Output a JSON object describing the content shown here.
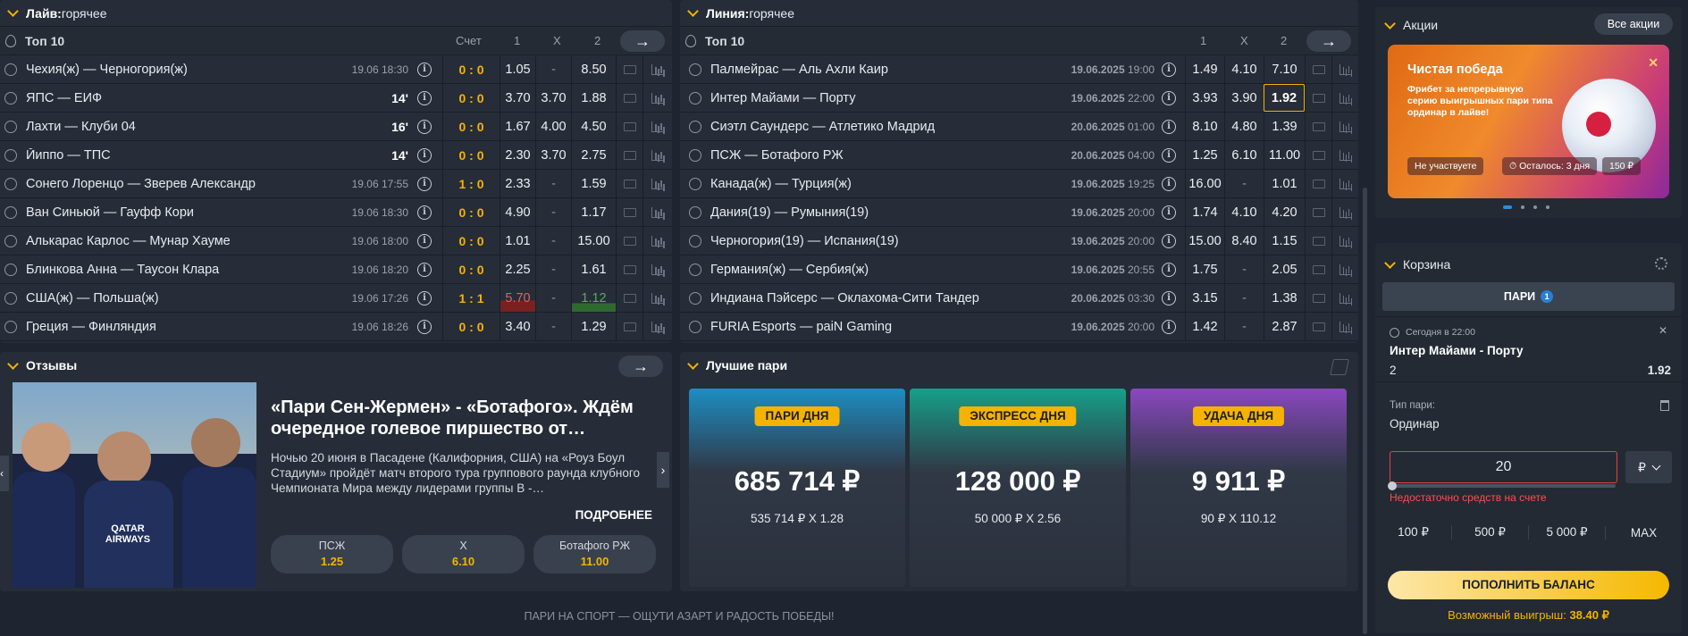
{
  "live": {
    "title_bold": "Лайв:",
    "title_rest": " горячее",
    "top": "Топ 10",
    "h_score": "Счет",
    "h1": "1",
    "hx": "X",
    "h2": "2",
    "rows": [
      {
        "name": "Чехия(ж) — Черногория(ж)",
        "date": "19.06",
        "time": "18:30",
        "min": "",
        "score": "0 : 0",
        "o1": "1.05",
        "ox": "-",
        "o2": "8.50",
        "hl": ""
      },
      {
        "name": "ЯПС — ЕИФ",
        "date": "",
        "time": "",
        "min": "14'",
        "score": "0 : 0",
        "o1": "3.70",
        "ox": "3.70",
        "o2": "1.88",
        "hl": ""
      },
      {
        "name": "Лахти — Клуби 04",
        "date": "",
        "time": "",
        "min": "16'",
        "score": "0 : 0",
        "o1": "1.67",
        "ox": "4.00",
        "o2": "4.50",
        "hl": ""
      },
      {
        "name": "Йиппо — ТПС",
        "date": "",
        "time": "",
        "min": "14'",
        "score": "0 : 0",
        "o1": "2.30",
        "ox": "3.70",
        "o2": "2.75",
        "hl": ""
      },
      {
        "name": "Сонего Лоренцо — Зверев Александр",
        "date": "19.06",
        "time": "17:55",
        "min": "",
        "score": "1 : 0",
        "o1": "2.33",
        "ox": "-",
        "o2": "1.59",
        "hl": ""
      },
      {
        "name": "Ван Синьюй — Гауфф Кори",
        "date": "19.06",
        "time": "18:30",
        "min": "",
        "score": "0 : 0",
        "o1": "4.90",
        "ox": "-",
        "o2": "1.17",
        "hl": ""
      },
      {
        "name": "Алькарас Карлос — Мунар Хауме",
        "date": "19.06",
        "time": "18:00",
        "min": "",
        "score": "0 : 0",
        "o1": "1.01",
        "ox": "-",
        "o2": "15.00",
        "hl": ""
      },
      {
        "name": "Блинкова Анна — Таусон Клара",
        "date": "19.06",
        "time": "18:20",
        "min": "",
        "score": "0 : 0",
        "o1": "2.25",
        "ox": "-",
        "o2": "1.61",
        "hl": ""
      },
      {
        "name": "США(ж) — Польша(ж)",
        "date": "19.06",
        "time": "17:26",
        "min": "",
        "score": "1 : 1",
        "o1": "5.70",
        "ox": "-",
        "o2": "1.12",
        "hl": "down-up"
      },
      {
        "name": "Греция — Финляндия",
        "date": "19.06",
        "time": "18:26",
        "min": "",
        "score": "0 : 0",
        "o1": "3.40",
        "ox": "-",
        "o2": "1.29",
        "hl": ""
      }
    ]
  },
  "line": {
    "title_bold": "Линия:",
    "title_rest": " горячее",
    "top": "Топ 10",
    "h1": "1",
    "hx": "X",
    "h2": "2",
    "rows": [
      {
        "name": "Палмейрас — Аль Ахли Каир",
        "date": "19.06.2025",
        "time": "19:00",
        "o1": "1.49",
        "ox": "4.10",
        "o2": "7.10"
      },
      {
        "name": "Интер Майами — Порту",
        "date": "19.06.2025",
        "time": "22:00",
        "o1": "3.93",
        "ox": "3.90",
        "o2": "1.92"
      },
      {
        "name": "Сиэтл Саундерс — Атлетико Мадрид",
        "date": "20.06.2025",
        "time": "01:00",
        "o1": "8.10",
        "ox": "4.80",
        "o2": "1.39"
      },
      {
        "name": "ПСЖ — Ботафого РЖ",
        "date": "20.06.2025",
        "time": "04:00",
        "o1": "1.25",
        "ox": "6.10",
        "o2": "11.00"
      },
      {
        "name": "Канада(ж) — Турция(ж)",
        "date": "19.06.2025",
        "time": "19:25",
        "o1": "16.00",
        "ox": "-",
        "o2": "1.01"
      },
      {
        "name": "Дания(19) — Румыния(19)",
        "date": "19.06.2025",
        "time": "20:00",
        "o1": "1.74",
        "ox": "4.10",
        "o2": "4.20"
      },
      {
        "name": "Черногория(19) — Испания(19)",
        "date": "19.06.2025",
        "time": "20:00",
        "o1": "15.00",
        "ox": "8.40",
        "o2": "1.15"
      },
      {
        "name": "Германия(ж) — Сербия(ж)",
        "date": "19.06.2025",
        "time": "20:55",
        "o1": "1.75",
        "ox": "-",
        "o2": "2.05"
      },
      {
        "name": "Индиана Пэйсерс — Оклахома-Сити Тандер",
        "date": "20.06.2025",
        "time": "03:30",
        "o1": "3.15",
        "ox": "-",
        "o2": "1.38"
      },
      {
        "name": "FURIA Esports — paiN Gaming",
        "date": "19.06.2025",
        "time": "20:00",
        "o1": "1.42",
        "ox": "-",
        "o2": "2.87"
      }
    ],
    "selected_row": 1
  },
  "reviews": {
    "title": "Отзывы",
    "headline": "«Пари Сен-Жермен» - «Ботафого». Ждём очередное голевое пиршество от…",
    "body": "Ночью 20 июня в Пасадене (Калифорния, США) на «Роуз Боул Стадиум» пройдёт матч второго тура группового раунда клубного Чемпионата Мира между лидерами группы B -…",
    "more": "ПОДРОБНЕЕ",
    "image_text": "QATAR AIRWAYS",
    "bets": [
      {
        "label": "ПСЖ",
        "odd": "1.25"
      },
      {
        "label": "Х",
        "odd": "6.10"
      },
      {
        "label": "Ботафого РЖ",
        "odd": "11.00"
      }
    ]
  },
  "best": {
    "title": "Лучшие пари",
    "cards": [
      {
        "badge": "ПАРИ ДНЯ",
        "amount": "685 714 ₽",
        "calc": "535 714 ₽ X 1.28",
        "color": "#1d8ec2"
      },
      {
        "badge": "ЭКСПРЕСС ДНЯ",
        "amount": "128 000 ₽",
        "calc": "50 000 ₽ X 2.56",
        "color": "#16a08a"
      },
      {
        "badge": "УДАЧА ДНЯ",
        "amount": "9 911 ₽",
        "calc": "90 ₽ X 110.12",
        "color": "#8a48c0"
      }
    ]
  },
  "footer": "ПАРИ НА СПОРТ — ОЩУТИ АЗАРТ И РАДОСТЬ ПОБЕДЫ!",
  "promo": {
    "title": "Акции",
    "all": "Все акции",
    "card_title": "Чистая победа",
    "card_text": "Фрибет за непрерывную серию выигрышных пари типа ординар в лайве!",
    "status": "Не участвуете",
    "left": "Осталось: 3 дня",
    "prize": "150 ₽"
  },
  "cart": {
    "title": "Корзина",
    "tab": "ПАРИ",
    "tab_count": "1",
    "when": "Сегодня в 22:00",
    "match": "Интер Майами - Порту",
    "outcome": "2",
    "odd": "1.92",
    "type_label": "Тип пари:",
    "type": "Ординар",
    "stake": "20",
    "currency": "₽",
    "error": "Недостаточно средств на счете",
    "quick": [
      "100 ₽",
      "500 ₽",
      "5 000 ₽",
      "MAX"
    ],
    "deposit": "ПОПОЛНИТЬ БАЛАНС",
    "win_label": "Возможный выигрыш: ",
    "win": "38.40 ₽"
  }
}
